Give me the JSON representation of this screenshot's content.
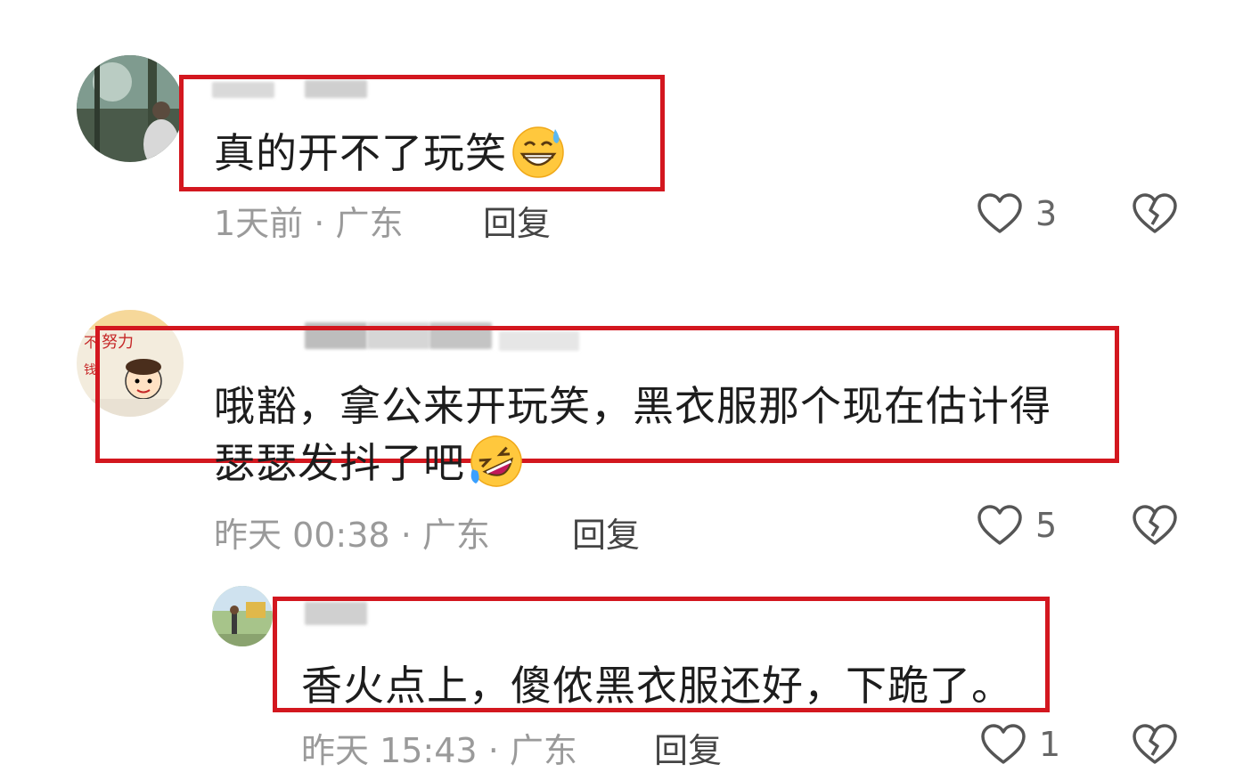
{
  "comments": [
    {
      "text": "真的开不了玩笑",
      "emoji": "grinning-sweat-emoji",
      "time": "1天前",
      "location": "广东",
      "reply_label": "回复",
      "likes": "3"
    },
    {
      "text_line1": "哦豁，拿公来开玩笑，黑衣服那个现在估计得",
      "text_line2": "瑟瑟发抖了吧",
      "emoji": "rolling-laughing-emoji",
      "time": "昨天 00:38",
      "location": "广东",
      "reply_label": "回复",
      "likes": "5"
    },
    {
      "text": "香火点上，傻侬黑衣服还好，下跪了。",
      "time": "昨天 15:43",
      "location": "广东",
      "reply_label": "回复",
      "likes": "1"
    }
  ],
  "separator": "·",
  "colors": {
    "highlight_box": "#d3171f",
    "meta_text": "#9a9a9a",
    "icon_stroke": "#555555"
  }
}
